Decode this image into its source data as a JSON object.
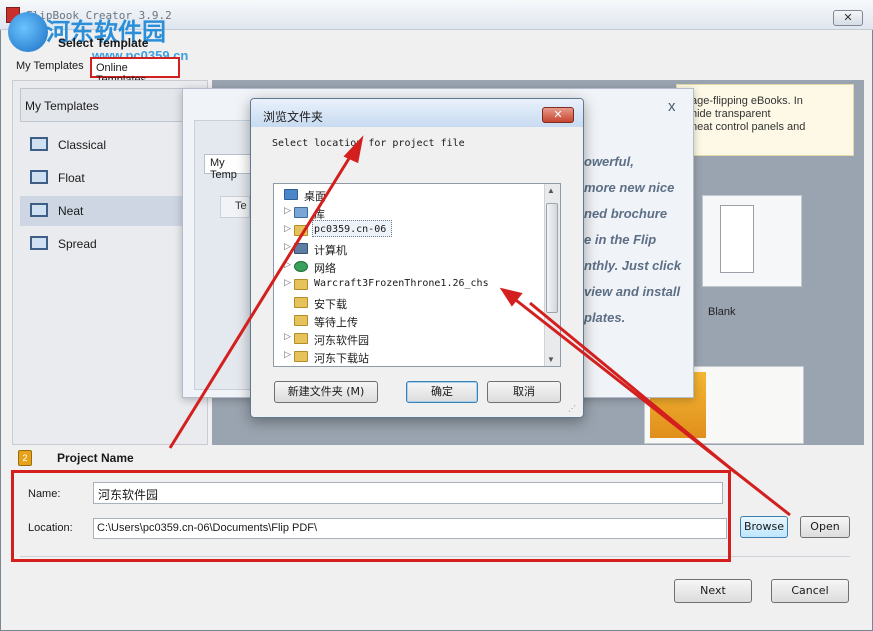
{
  "window": {
    "title": "FlipBook Creator 3.9.2",
    "close_glyph": "✕",
    "logo_text": "河东软件园",
    "logo_url": "www.pc0359.cn"
  },
  "step1": {
    "title": "Select Template",
    "tabs": [
      "My Templates",
      "Online Templates"
    ],
    "list_header": "My Templates",
    "templates": [
      "Classical",
      "Float",
      "Neat",
      "Spread"
    ]
  },
  "right_panel": {
    "info_lines": [
      "age-flipping eBooks. In",
      "hide transparent",
      "neat control panels and"
    ],
    "blank_label": "Blank"
  },
  "modal_bg": {
    "close_glyph": "x",
    "tab_label": "My Temp",
    "sub_label": "Te",
    "text_lines": [
      "owerful,",
      "more new nice",
      "ned brochure",
      "e in the Flip",
      "nthly. Just click",
      "view and install",
      "plates."
    ]
  },
  "browse_dialog": {
    "title": "浏览文件夹",
    "close_glyph": "✕",
    "description": "Select location for project file",
    "tree": [
      {
        "label": "桌面",
        "has_arrow": false
      },
      {
        "label": "库",
        "has_arrow": true
      },
      {
        "label": "pc0359.cn-06",
        "has_arrow": true
      },
      {
        "label": "计算机",
        "has_arrow": true
      },
      {
        "label": "网络",
        "has_arrow": true
      },
      {
        "label": "Warcraft3FrozenThrone1.26_chs",
        "has_arrow": true
      },
      {
        "label": "安下载",
        "has_arrow": false
      },
      {
        "label": "等待上传",
        "has_arrow": false
      },
      {
        "label": "河东软件园",
        "has_arrow": true
      },
      {
        "label": "河东下载站",
        "has_arrow": true
      }
    ],
    "buttons": {
      "new_folder": "新建文件夹 (M)",
      "ok": "确定",
      "cancel": "取消"
    }
  },
  "step2": {
    "number": "2",
    "title": "Project Name",
    "name_label": "Name:",
    "name_value": "河东软件园",
    "location_label": "Location:",
    "location_value": "C:\\Users\\pc0359.cn-06\\Documents\\Flip PDF\\",
    "browse": "Browse",
    "open": "Open"
  },
  "footer": {
    "next": "Next",
    "cancel": "Cancel"
  },
  "colors": {
    "annotation_red": "#d41f1f",
    "accent_blue": "#3c7fb1"
  }
}
